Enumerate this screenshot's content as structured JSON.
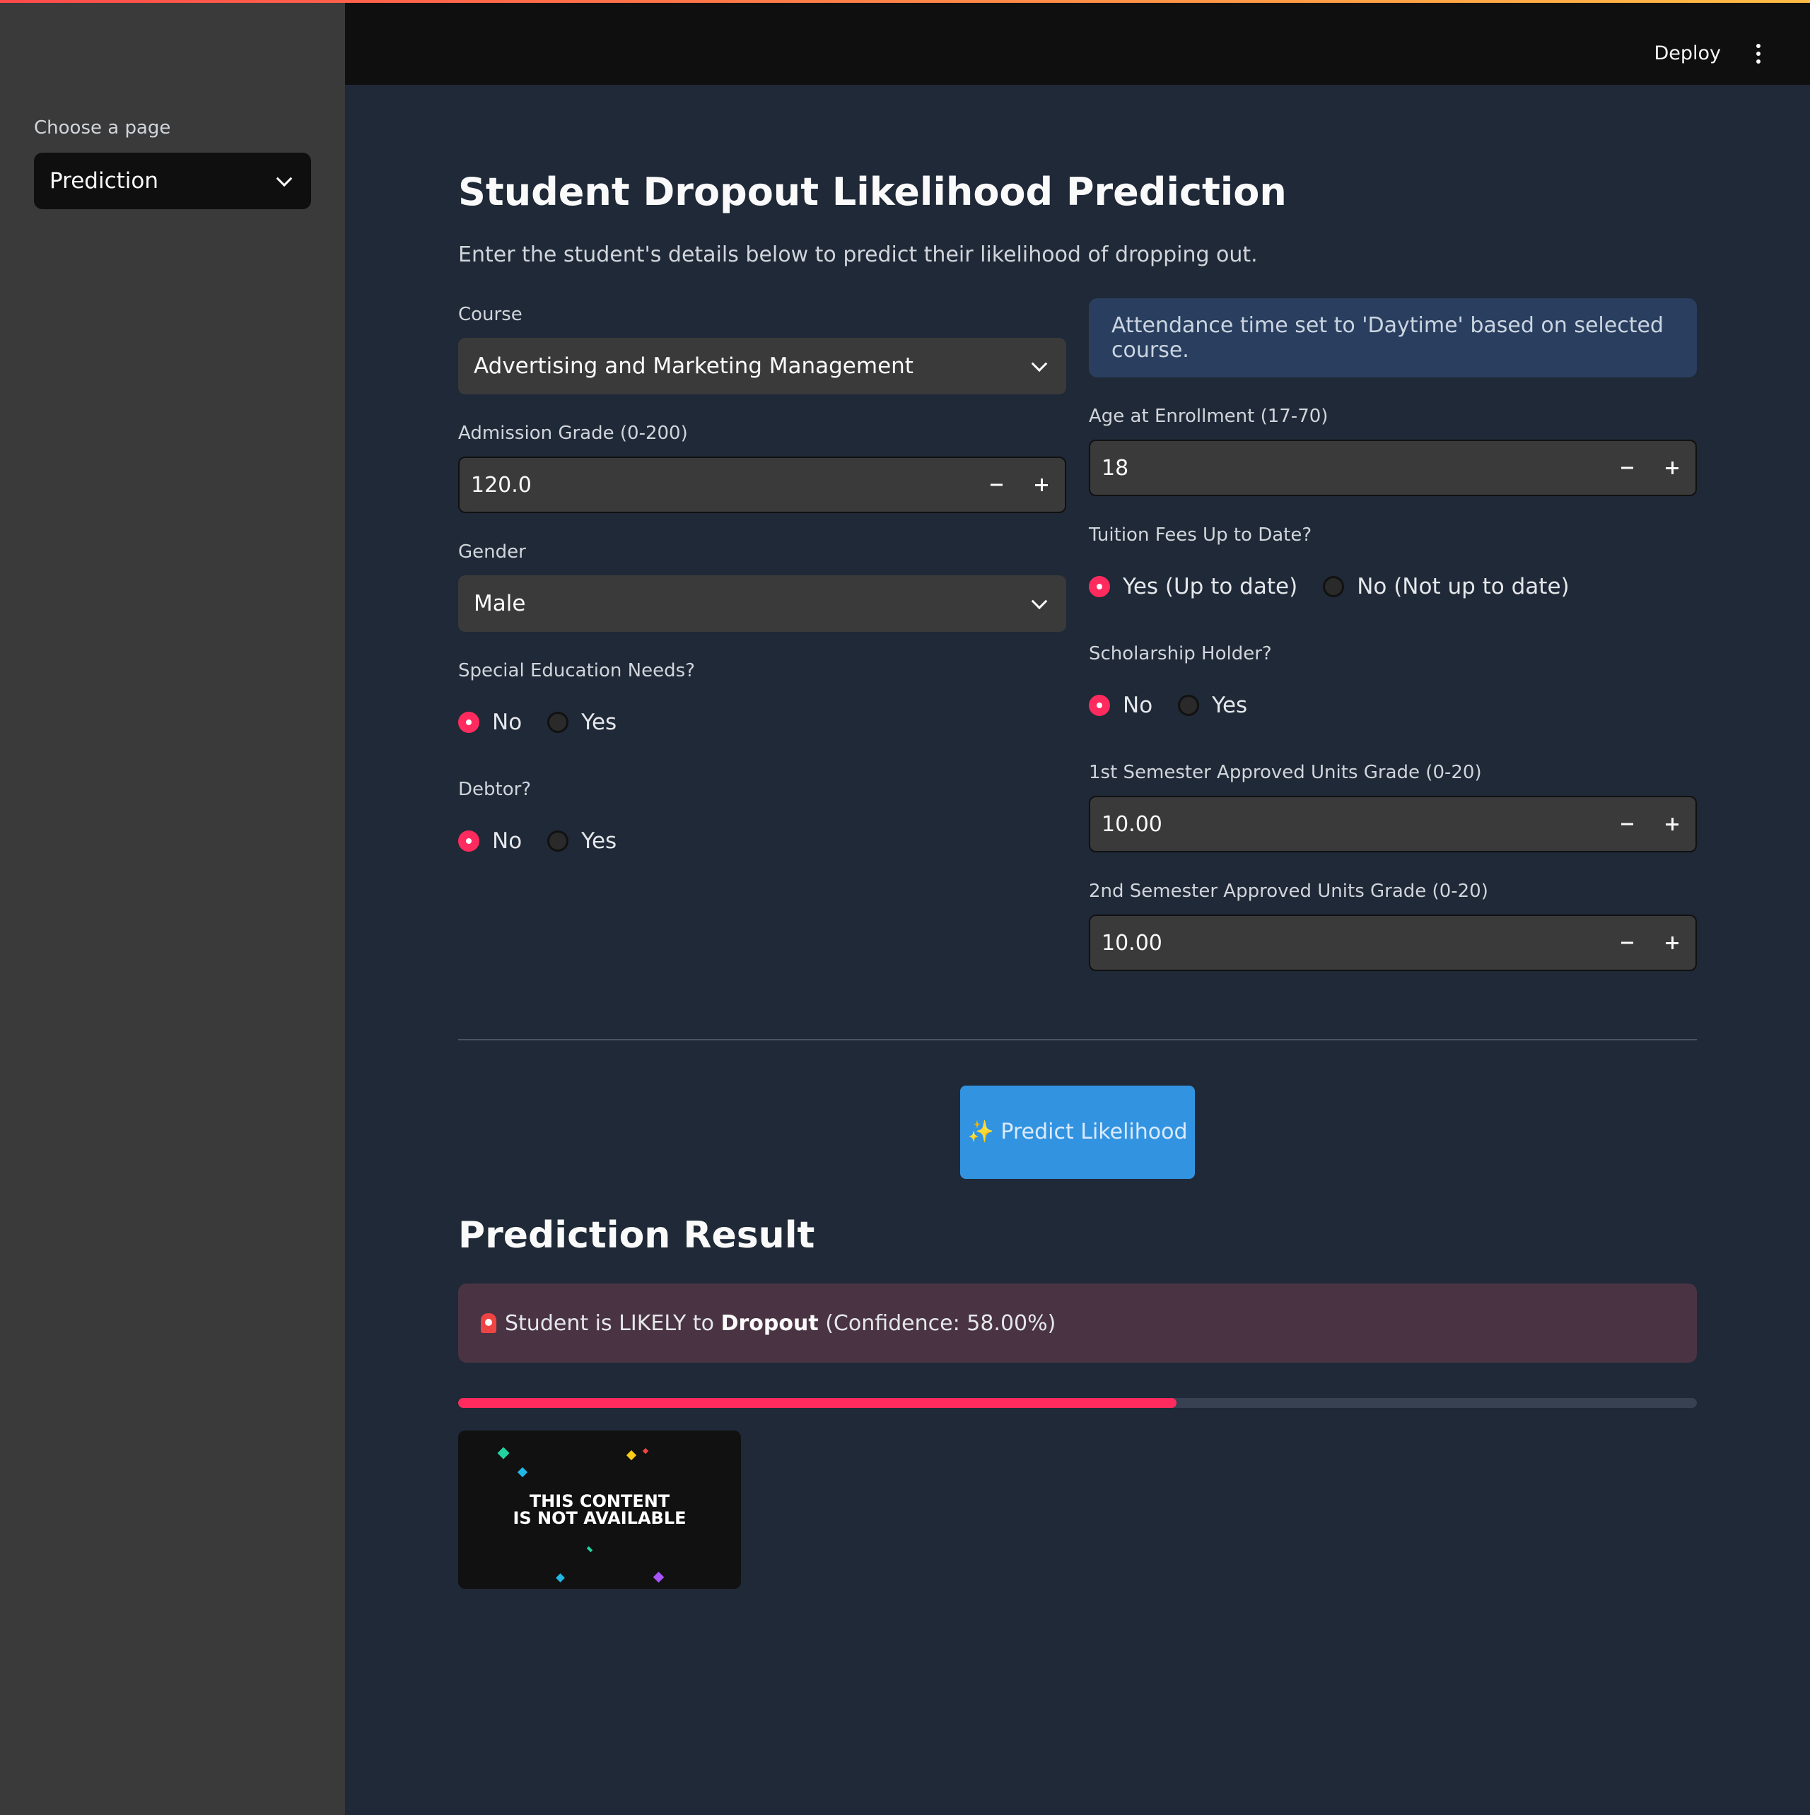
{
  "sidebar": {
    "label": "Choose a page",
    "selected_page": "Prediction"
  },
  "header": {
    "deploy_label": "Deploy"
  },
  "main": {
    "title": "Student Dropout Likelihood Prediction",
    "subtitle": "Enter the student's details below to predict their likelihood of dropping out."
  },
  "form": {
    "course": {
      "label": "Course",
      "value": "Advertising and Marketing Management"
    },
    "attendance_info": "Attendance time set to 'Daytime' based on selected course.",
    "age": {
      "label": "Age at Enrollment (17-70)",
      "value": "18"
    },
    "admission_grade": {
      "label": "Admission Grade (0-200)",
      "value": "120.0"
    },
    "tuition": {
      "label": "Tuition Fees Up to Date?",
      "options": [
        "Yes (Up to date)",
        "No (Not up to date)"
      ],
      "selected": 0
    },
    "gender": {
      "label": "Gender",
      "value": "Male"
    },
    "scholarship": {
      "label": "Scholarship Holder?",
      "options": [
        "No",
        "Yes"
      ],
      "selected": 0
    },
    "special_ed": {
      "label": "Special Education Needs?",
      "options": [
        "No",
        "Yes"
      ],
      "selected": 0
    },
    "sem1": {
      "label": "1st Semester Approved Units Grade (0-20)",
      "value": "10.00"
    },
    "debtor": {
      "label": "Debtor?",
      "options": [
        "No",
        "Yes"
      ],
      "selected": 0
    },
    "sem2": {
      "label": "2nd Semester Approved Units Grade (0-20)",
      "value": "10.00"
    }
  },
  "predict_button": {
    "icon": "✨",
    "label": "Predict Likelihood"
  },
  "result": {
    "title": "Prediction Result",
    "alert_prefix": "Student is LIKELY to ",
    "alert_outcome": "Dropout",
    "alert_suffix": " (Confidence: 58.00%)",
    "confidence_fraction": 0.58,
    "media_text_line1": "THIS CONTENT",
    "media_text_line2": "IS NOT AVAILABLE"
  },
  "colors": {
    "accent": "#ff2b5e",
    "button": "#3294e0",
    "background": "#1f2937",
    "sidebar": "#3a3a3a"
  }
}
